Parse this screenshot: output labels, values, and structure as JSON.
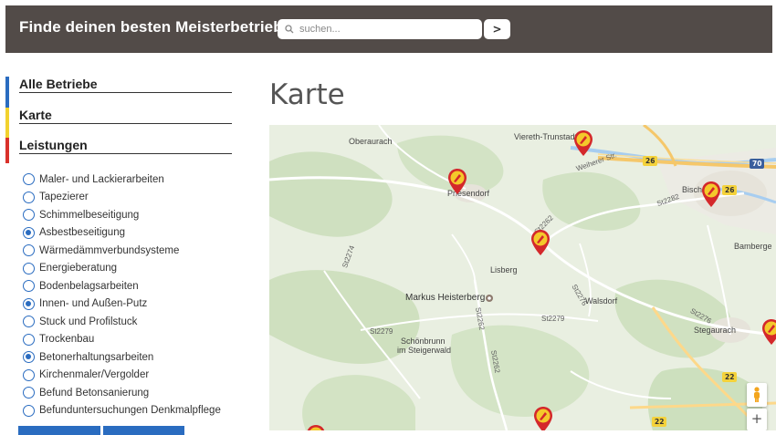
{
  "header": {
    "brand": "Finde deinen besten Meisterbetrieb",
    "search_placeholder": "suchen...",
    "go_label": ">"
  },
  "sidebar": {
    "nav": [
      {
        "label": "Alle Betriebe",
        "color": "#2a6cc0"
      },
      {
        "label": "Karte",
        "color": "#f2d22e"
      },
      {
        "label": "Leistungen",
        "color": "#d9312b"
      }
    ],
    "options": [
      {
        "label": "Maler- und Lackierarbeiten",
        "checked": false
      },
      {
        "label": "Tapezierer",
        "checked": false
      },
      {
        "label": "Schimmelbeseitigung",
        "checked": false
      },
      {
        "label": "Asbestbeseitigung",
        "checked": true
      },
      {
        "label": "Wärmedämmverbundsysteme",
        "checked": false
      },
      {
        "label": "Energieberatung",
        "checked": false
      },
      {
        "label": "Bodenbelagsarbeiten",
        "checked": false
      },
      {
        "label": "Innen- und Außen-Putz",
        "checked": true
      },
      {
        "label": "Stuck und Profilstuck",
        "checked": false
      },
      {
        "label": "Trockenbau",
        "checked": false
      },
      {
        "label": "Betonerhaltungsarbeiten",
        "checked": true
      },
      {
        "label": "Kirchenmaler/Vergolder",
        "checked": false
      },
      {
        "label": "Befund Betonsanierung",
        "checked": false
      },
      {
        "label": "Befunduntersuchungen Denkmalpflege",
        "checked": false
      }
    ]
  },
  "main": {
    "title": "Karte"
  },
  "map": {
    "places": [
      "Oberaurach",
      "Viereth-Trunstadt",
      "Priesendorf",
      "Bisch",
      "Bamberge",
      "Lisberg",
      "Markus Heisterberg",
      "Walsdorf",
      "Stegaurach",
      "Schönbrunn",
      "im Steigerwald"
    ],
    "roads": [
      "St2274",
      "St2262",
      "St2276",
      "St2279",
      "St2262",
      "St2262",
      "St2279",
      "St2282",
      "St2276",
      "Weiherer Str."
    ],
    "shields": [
      "26",
      "70",
      "26",
      "22",
      "22"
    ],
    "zoom_in": "+"
  }
}
